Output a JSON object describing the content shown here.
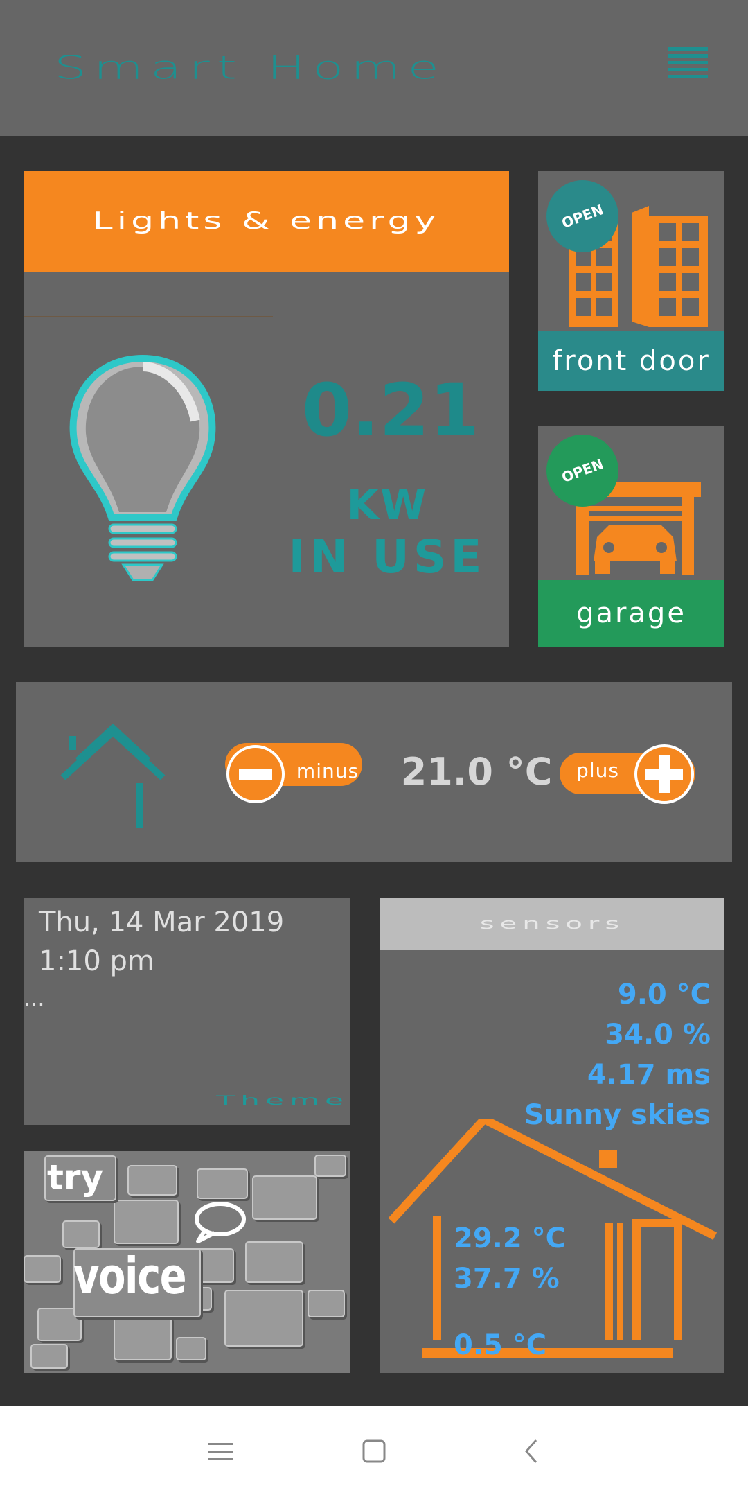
{
  "header": {
    "title": "Smart Home",
    "menu_icon": "hamburger-menu-icon"
  },
  "lights": {
    "title": "Lights & energy",
    "value": "0.21",
    "unit": "KW",
    "status": "IN USE",
    "icon": "lightbulb-icon"
  },
  "front_door": {
    "label": "front door",
    "badge": "OPEN",
    "icon": "door-icon"
  },
  "garage": {
    "label": "garage",
    "badge": "OPEN",
    "icon": "garage-icon"
  },
  "thermostat": {
    "minus_label": "minus",
    "plus_label": "plus",
    "temperature": "21.0 °C",
    "icon": "home-outline-icon"
  },
  "datetime": {
    "date": "Thu, 14 Mar 2019",
    "time": "1:10 pm",
    "extra": "...",
    "theme_label": "Theme"
  },
  "voice": {
    "try_label": "try",
    "voice_label": "voice",
    "icon": "speech-bubble-icon"
  },
  "sensors": {
    "title": "sensors",
    "outdoor_temperature": "9.0 °C",
    "outdoor_humidity": "34.0 %",
    "wind_speed": "4.17 ms",
    "weather": "Sunny skies",
    "indoor_temperature": "29.2 °C",
    "indoor_humidity": "37.7 %",
    "floor_temperature": "0.5 °C"
  },
  "nav": {
    "menu_icon": "recent-apps-icon",
    "home_icon": "home-square-icon",
    "back_icon": "back-chevron-icon"
  },
  "colors": {
    "accent_orange": "#f5871f",
    "accent_teal": "#1e9090",
    "accent_green": "#239a5a",
    "sensor_blue": "#44a8f5",
    "panel_gray": "#666666",
    "background": "#333333"
  }
}
